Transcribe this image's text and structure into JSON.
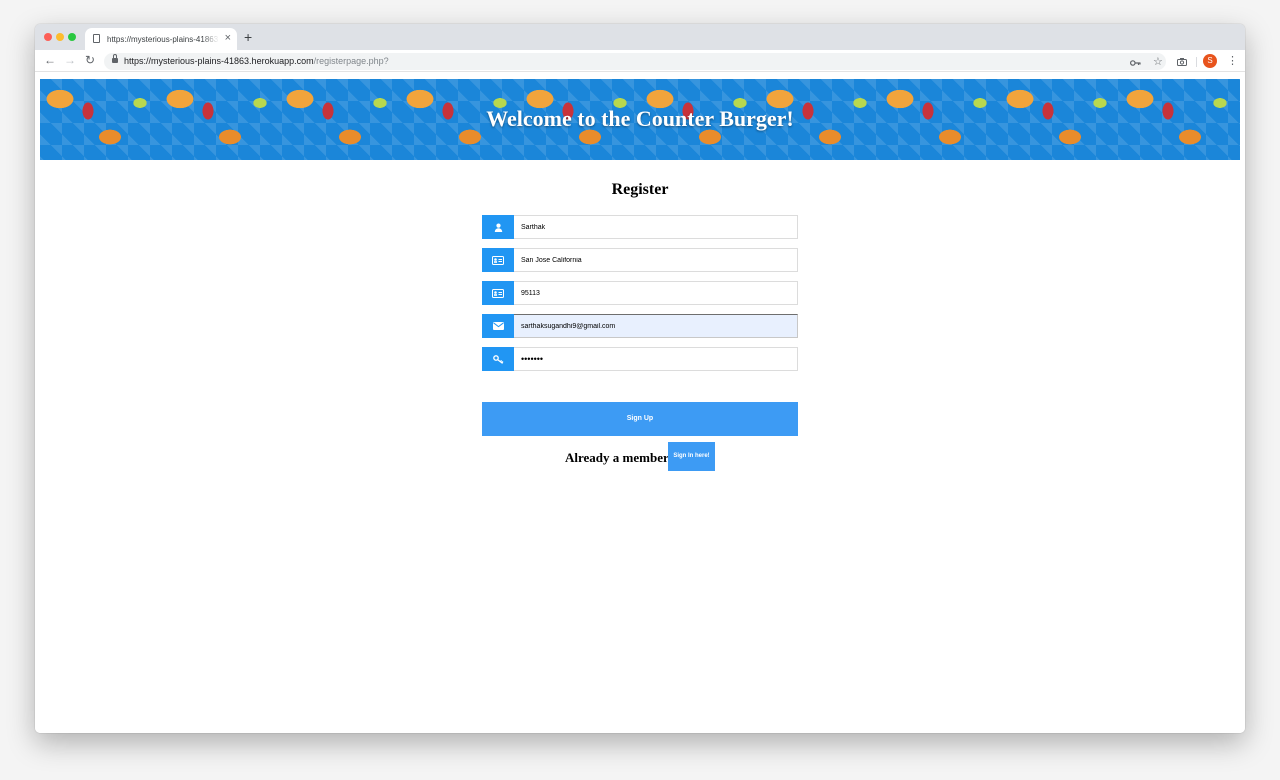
{
  "browser": {
    "tab_title": "https://mysterious-plains-41863",
    "tab_close": "×",
    "new_tab": "+",
    "back": "←",
    "forward": "→",
    "reload": "↻",
    "url_host": "https://mysterious-plains-41863.herokuapp.com",
    "url_path": "/registerpage.php?",
    "avatar_letter": "S",
    "icons": [
      "back-icon",
      "forward-icon",
      "reload-icon",
      "lock-icon",
      "key-icon",
      "star-icon",
      "camera-icon",
      "menu-icon"
    ]
  },
  "banner": {
    "title": "Welcome to the Counter Burger!"
  },
  "form": {
    "heading": "Register",
    "fields": [
      {
        "name": "name",
        "value": "Sarthak",
        "icon": "user-icon"
      },
      {
        "name": "address",
        "value": "San Jose California",
        "icon": "id-card-icon"
      },
      {
        "name": "zip",
        "value": "95113",
        "icon": "id-card-icon"
      },
      {
        "name": "email",
        "value": "sarthaksugandhi9@gmail.com",
        "icon": "envelope-icon"
      },
      {
        "name": "password",
        "value": "•••••••",
        "icon": "key-icon"
      }
    ],
    "signup_label": "Sign Up",
    "member_text": "Already a member?",
    "signin_label": "Sign In here!"
  },
  "colors": {
    "accent": "#2196f3",
    "button": "#3d9bf4",
    "autofill": "#e8f0fe",
    "banner_bg": "#1b86d9"
  }
}
